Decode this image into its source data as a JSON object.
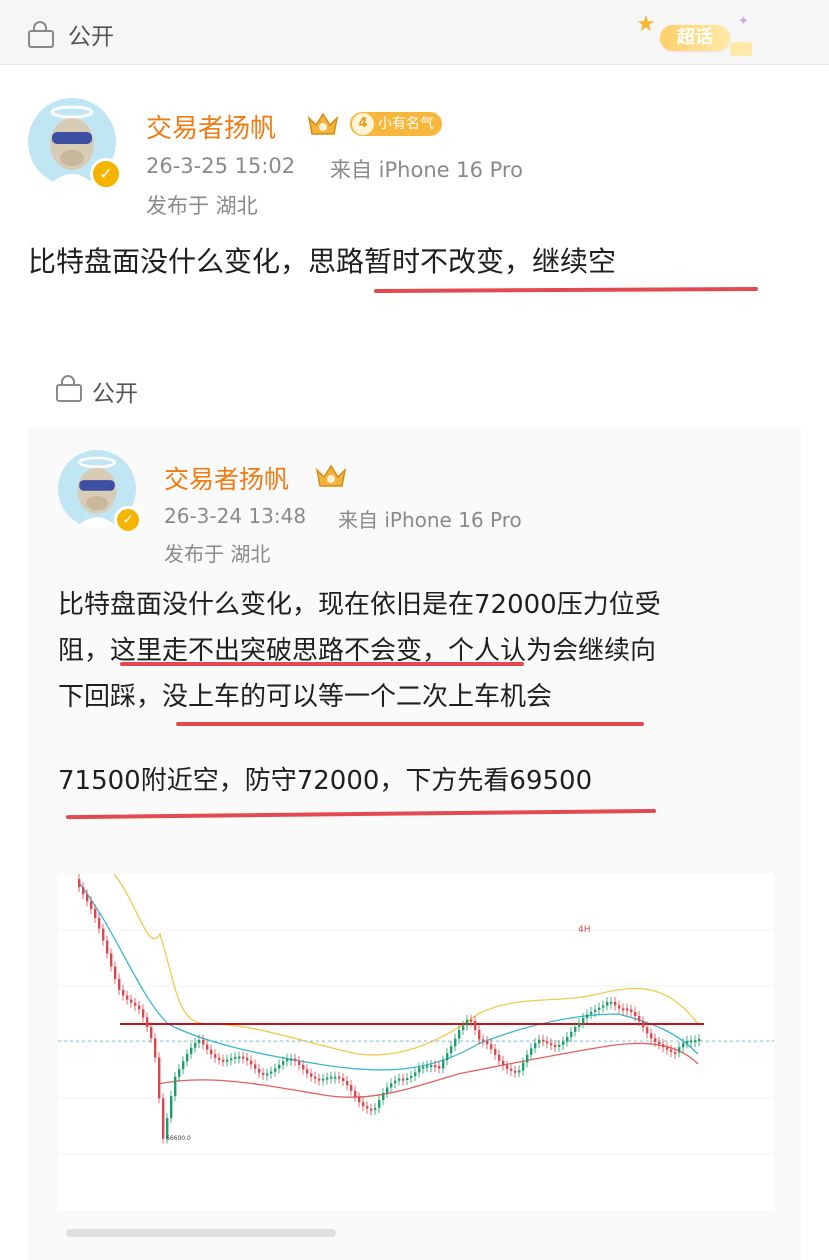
{
  "top_bar": {
    "visibility": "公开",
    "super_badge": "超话"
  },
  "post": {
    "author": "交易者扬帆",
    "level_number": "4",
    "level_label": "小有名气",
    "timestamp": "26-3-25 15:02",
    "source": "来自 iPhone 16 Pro",
    "location": "发布于 湖北",
    "text": "比特盘面没什么变化，思路暂时不改变，继续空"
  },
  "repost": {
    "visibility": "公开",
    "author": "交易者扬帆",
    "timestamp": "26-3-24 13:48",
    "source": "来自 iPhone 16 Pro",
    "location": "发布于 湖北",
    "para1_line1": "比特盘面没什么变化，现在依旧是在72000压力位受",
    "para1_line2": "阻，这里走不出突破思路不会变，个人认为会继续向",
    "para1_line3": "下回踩，没上车的可以等一个二次上车机会",
    "para2": "71500附近空，防守72000，下方先看69500"
  },
  "chart_data": {
    "type": "candlestick",
    "timeframe_label": "4H",
    "low_marker_label": "66600.0",
    "resistance_line": "red horizontal",
    "current_price_line": "dashed cyan",
    "colors": {
      "up": "#1e9e6a",
      "down": "#d9484e",
      "resistance": "#c0141b",
      "ma_yellow": "#f2c94c",
      "ma_cyan": "#39b7d5",
      "ma_red": "#e45f5f"
    }
  }
}
